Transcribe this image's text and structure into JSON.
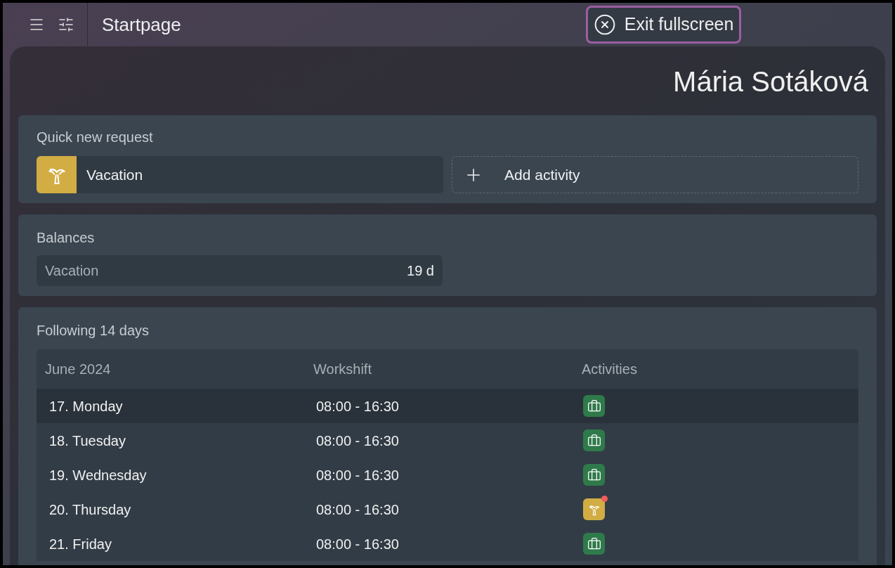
{
  "header": {
    "title": "Startpage"
  },
  "exit_button": {
    "label": "Exit fullscreen"
  },
  "user": {
    "name": "Mária Sotáková"
  },
  "quick_request": {
    "title": "Quick new request",
    "items": [
      {
        "kind": "vacation",
        "label": "Vacation"
      },
      {
        "kind": "add",
        "label": "Add activity"
      }
    ]
  },
  "balances": {
    "title": "Balances",
    "items": [
      {
        "label": "Vacation",
        "value": "19 d"
      }
    ]
  },
  "schedule": {
    "title": "Following 14 days",
    "columns": [
      "June 2024",
      "Workshift",
      "Activities"
    ],
    "rows": [
      {
        "day": "17. Monday",
        "shift": "08:00 - 16:30",
        "selected": true,
        "activity": {
          "kind": "work",
          "notified": false
        }
      },
      {
        "day": "18. Tuesday",
        "shift": "08:00 - 16:30",
        "selected": false,
        "activity": {
          "kind": "work",
          "notified": false
        }
      },
      {
        "day": "19. Wednesday",
        "shift": "08:00 - 16:30",
        "selected": false,
        "activity": {
          "kind": "work",
          "notified": false
        }
      },
      {
        "day": "20. Thursday",
        "shift": "08:00 - 16:30",
        "selected": false,
        "activity": {
          "kind": "vacation",
          "notified": true
        }
      },
      {
        "day": "21. Friday",
        "shift": "08:00 - 16:30",
        "selected": false,
        "activity": {
          "kind": "work",
          "notified": false
        }
      }
    ]
  }
}
